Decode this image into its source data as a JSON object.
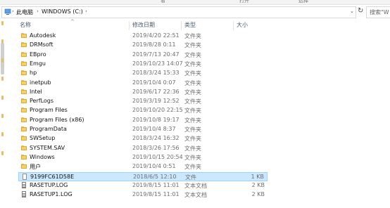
{
  "ribbon": {
    "partial_labels": [
      "看",
      "打开",
      "选择"
    ]
  },
  "address": {
    "crumbs": [
      "此电脑",
      "WINDOWS (C:)"
    ],
    "search_placeholder": "搜索\"W"
  },
  "columns": {
    "name": "名称",
    "date": "修改日期",
    "type": "类型",
    "size": "大小"
  },
  "rows": [
    {
      "name": "Autodesk",
      "date": "2019/4/20 22:51",
      "type": "文件夹",
      "size": "",
      "icon": "folder-icon"
    },
    {
      "name": "DRMsoft",
      "date": "2019/8/28 0:11",
      "type": "文件夹",
      "size": "",
      "icon": "folder-icon"
    },
    {
      "name": "EBpro",
      "date": "2019/7/13 20:47",
      "type": "文件夹",
      "size": "",
      "icon": "folder-icon"
    },
    {
      "name": "Emgu",
      "date": "2019/10/23 14:07",
      "type": "文件夹",
      "size": "",
      "icon": "folder-icon"
    },
    {
      "name": "hp",
      "date": "2018/3/24 15:33",
      "type": "文件夹",
      "size": "",
      "icon": "folder-icon"
    },
    {
      "name": "inetpub",
      "date": "2019/10/4 0:07",
      "type": "文件夹",
      "size": "",
      "icon": "folder-icon"
    },
    {
      "name": "Intel",
      "date": "2019/6/17 22:36",
      "type": "文件夹",
      "size": "",
      "icon": "folder-icon"
    },
    {
      "name": "PerfLogs",
      "date": "2019/3/19 12:52",
      "type": "文件夹",
      "size": "",
      "icon": "folder-icon"
    },
    {
      "name": "Program Files",
      "date": "2019/10/20 22:15",
      "type": "文件夹",
      "size": "",
      "icon": "folder-icon"
    },
    {
      "name": "Program Files (x86)",
      "date": "2019/10/8 19:17",
      "type": "文件夹",
      "size": "",
      "icon": "folder-icon"
    },
    {
      "name": "ProgramData",
      "date": "2019/10/4 8:37",
      "type": "文件夹",
      "size": "",
      "icon": "folder-icon"
    },
    {
      "name": "SWSetup",
      "date": "2018/3/24 16:32",
      "type": "文件夹",
      "size": "",
      "icon": "folder-icon"
    },
    {
      "name": "SYSTEM.SAV",
      "date": "2018/3/26 17:56",
      "type": "文件夹",
      "size": "",
      "icon": "folder-icon"
    },
    {
      "name": "Windows",
      "date": "2019/10/15 20:54",
      "type": "文件夹",
      "size": "",
      "icon": "folder-icon"
    },
    {
      "name": "用户",
      "date": "2019/10/4 0:51",
      "type": "文件夹",
      "size": "",
      "icon": "folder-icon"
    },
    {
      "name": "9199FC61D58E",
      "date": "2018/6/5 12:10",
      "type": "文件",
      "size": "1 KB",
      "icon": "file-icon"
    },
    {
      "name": "RASETUP.LOG",
      "date": "2019/8/15 11:01",
      "type": "文本文档",
      "size": "2 KB",
      "icon": "text-document-icon"
    },
    {
      "name": "RASETUP1.LOG",
      "date": "2019/8/15 11:01",
      "type": "文本文档",
      "size": "2 KB",
      "icon": "text-document-icon"
    }
  ],
  "selected_row_index": 15,
  "colors": {
    "selection_bg": "#cce8ff",
    "selection_border": "#99d1ff",
    "folder": "#f5cf6a"
  }
}
